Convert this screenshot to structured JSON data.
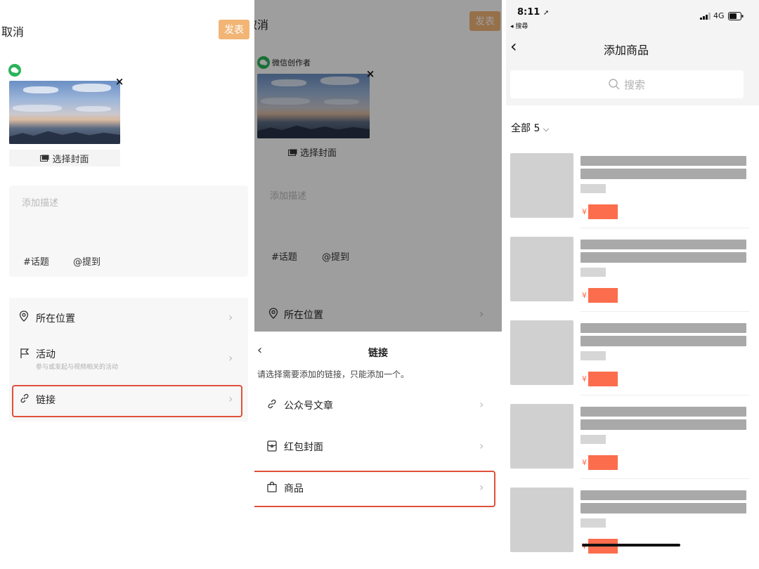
{
  "panel1": {
    "cancel_label": "取消",
    "publish_label": "发表",
    "cover_button_label": "选择封面",
    "description_placeholder": "添加描述",
    "tags": [
      "#话题",
      "@提到"
    ],
    "location_label": "所在位置",
    "activity_label": "活动",
    "activity_sub": "参与或发起与视频相关的活动",
    "link_label": "链接"
  },
  "panel2": {
    "cancel_label": "取消",
    "publish_label": "发表",
    "author_label": "微信创作者",
    "cover_button_label": "选择封面",
    "description_placeholder": "添加描述",
    "tags": [
      "#话题",
      "@提到"
    ],
    "location_label": "所在位置",
    "sheet_title": "链接",
    "sheet_hint": "请选择需要添加的链接，只能添加一个。",
    "options": [
      "公众号文章",
      "红包封面",
      "商品"
    ]
  },
  "panel3": {
    "status_time": "8:11",
    "status_back": "搜尋",
    "status_network": "4G",
    "nav_title": "添加商品",
    "search_placeholder": "搜索",
    "filter_label": "全部",
    "filter_count": "5",
    "currency_symbol": "¥",
    "product_count": 5
  },
  "colors": {
    "publish_orange": "#f2b576",
    "highlight_red": "#e0503a",
    "price_red": "#fb6d4d",
    "wechat_green": "#29b35a"
  }
}
